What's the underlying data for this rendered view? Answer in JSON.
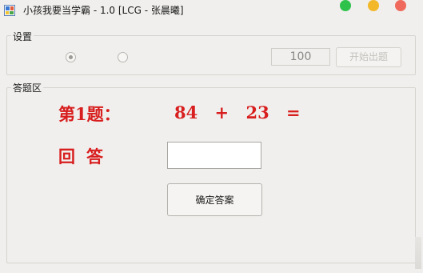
{
  "window": {
    "title": "小孩我要当学霸 - 1.0 [LCG - 张晨曦]",
    "controls": {
      "green": "#2fc24a",
      "yellow": "#f3b82a",
      "red": "#ef6a5c"
    }
  },
  "settings": {
    "legend": "设置",
    "radio_options": [
      {
        "selected": true
      },
      {
        "selected": false
      }
    ],
    "count_value": "100",
    "start_button_label": "开始出题"
  },
  "answer_area": {
    "legend": "答题区",
    "question_label": "第1题：",
    "expression": {
      "a": "84",
      "op": "+",
      "b": "23",
      "eq": "="
    },
    "answer_label": "回答",
    "answer_value": "",
    "confirm_button_label": "确定答案",
    "accent_color": "#d81e1e"
  }
}
